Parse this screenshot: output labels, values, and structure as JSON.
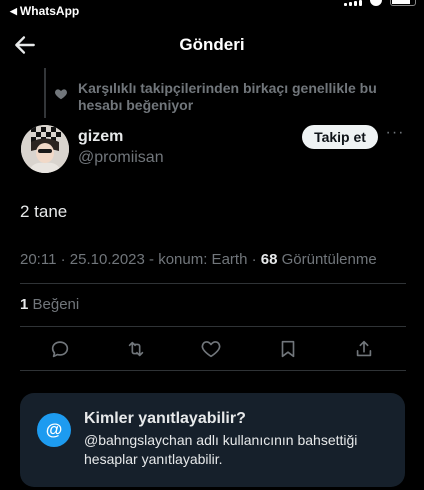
{
  "status_bar": {
    "back_app": "WhatsApp"
  },
  "header": {
    "title": "Gönderi"
  },
  "context": {
    "text": "Karşılıklı takipçilerinden birkaçı genellikle bu hesabı beğeniyor"
  },
  "author": {
    "name": "gizem",
    "handle": "@promiisan"
  },
  "follow_button": "Takip et",
  "more_glyph": "···",
  "post": {
    "text": "2 tane"
  },
  "meta": {
    "time": "20:11",
    "sep1": " · ",
    "date": "25.10.2023",
    "sep2": " - ",
    "location": "konum: Earth",
    "sep3": " · ",
    "views": "68",
    "views_label": " Görüntülenme"
  },
  "likes": {
    "count": "1",
    "label": " Beğeni"
  },
  "actions": [
    "reply-icon",
    "retweet-icon",
    "like-icon",
    "bookmark-icon",
    "share-icon"
  ],
  "reply_card": {
    "icon": "@",
    "title": "Kimler yanıtlayabilir?",
    "text": "@bahngslaychan adlı kullanıcının bahsettiği hesaplar yanıtlayabilir."
  },
  "colors": {
    "accent": "#1d9bf0",
    "muted": "#71767b",
    "card": "#16202b"
  }
}
